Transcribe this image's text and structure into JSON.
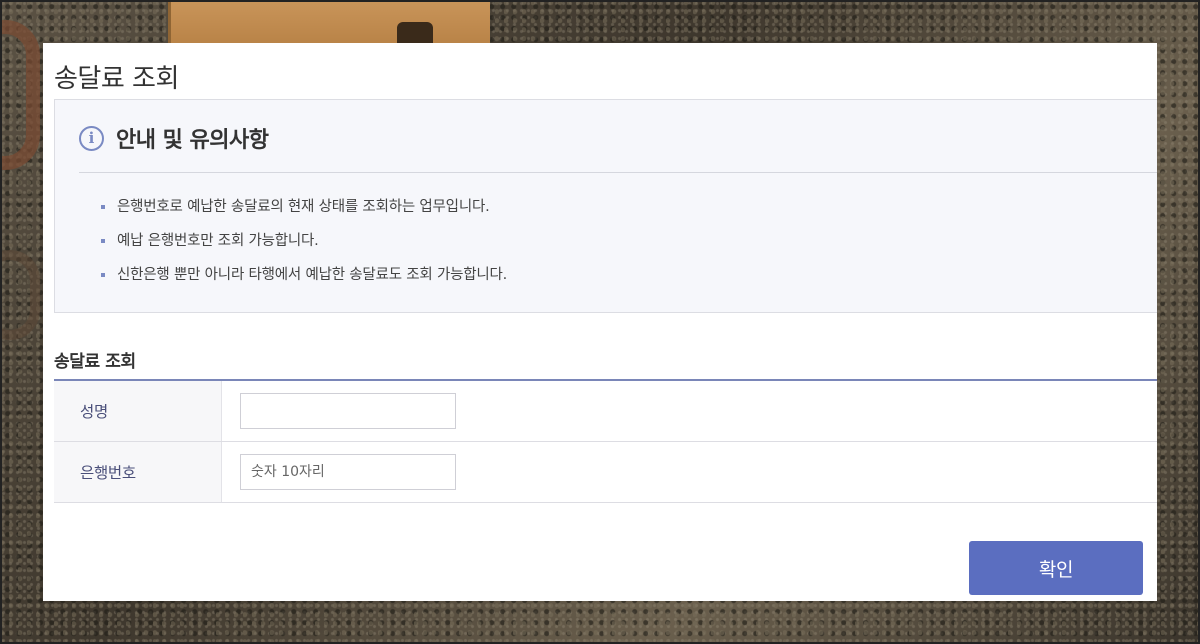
{
  "page": {
    "title": "송달료 조회"
  },
  "notice": {
    "icon": "info-icon",
    "title": "안내 및 유의사항",
    "items": [
      "은행번호로 예납한 송달료의 현재 상태를 조회하는 업무입니다.",
      "예납 은행번호만 조회 가능합니다.",
      "신한은행 뿐만 아니라 타행에서 예납한 송달료도 조회 가능합니다."
    ]
  },
  "form": {
    "section_title": "송달료 조회",
    "name_label": "성명",
    "name_value": "",
    "bank_label": "은행번호",
    "bank_placeholder": "숫자 10자리",
    "bank_value": ""
  },
  "actions": {
    "confirm_label": "확인"
  },
  "colors": {
    "accent": "#5b6ec0",
    "table_border": "#7a86b8",
    "label_text": "#4a4f7a"
  }
}
